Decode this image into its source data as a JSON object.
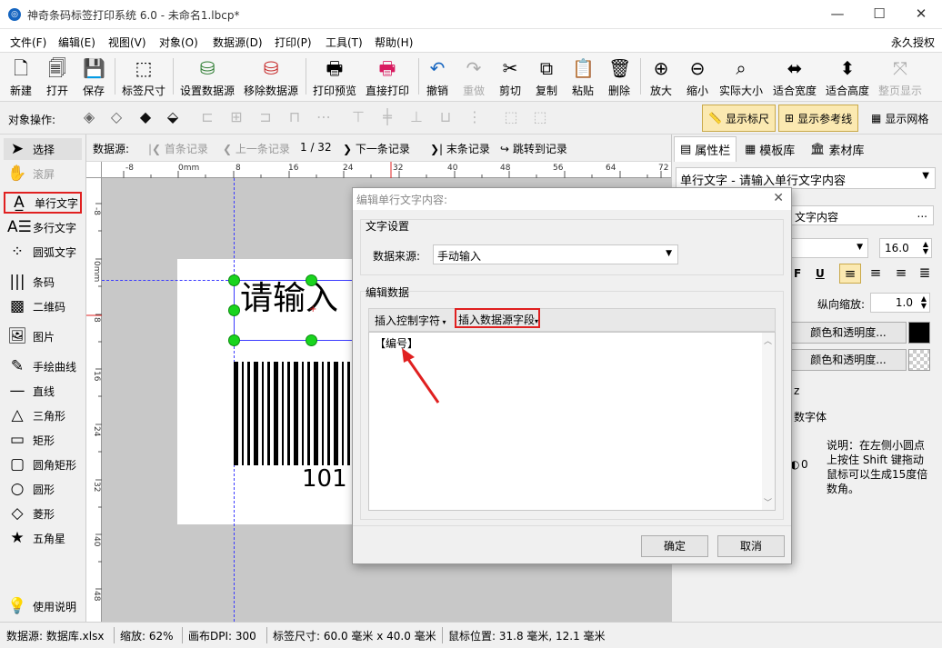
{
  "window": {
    "title": "神奇条码标签打印系统 6.0 - 未命名1.lbcp*",
    "app_icon": "app-logo-icon"
  },
  "menu": {
    "items": [
      "文件(F)",
      "编辑(E)",
      "视图(V)",
      "对象(O)",
      "数据源(D)",
      "打印(P)",
      "工具(T)",
      "帮助(H)"
    ],
    "license": "永久授权"
  },
  "toolbar": {
    "new": "新建",
    "open": "打开",
    "save": "保存",
    "label_size": "标签尺寸",
    "set_datasource": "设置数据源",
    "remove_datasource": "移除数据源",
    "print_preview": "打印预览",
    "direct_print": "直接打印",
    "undo": "撤销",
    "redo": "重做",
    "cut": "剪切",
    "copy": "复制",
    "paste": "粘贴",
    "delete": "删除",
    "zoom_in": "放大",
    "zoom_out": "缩小",
    "actual_size": "实际大小",
    "fit_width": "适合宽度",
    "fit_height": "适合高度",
    "fit_page": "整页显示"
  },
  "objbar": {
    "label": "对象操作:",
    "show_ruler": "显示标尺",
    "show_guides": "显示参考线",
    "show_grid": "显示网格"
  },
  "tools": {
    "select": "选择",
    "pan": "滚屏",
    "single_text": "单行文字",
    "multi_text": "多行文字",
    "arc_text": "圆弧文字",
    "barcode": "条码",
    "qrcode": "二维码",
    "image": "图片",
    "freehand": "手绘曲线",
    "line": "直线",
    "triangle": "三角形",
    "rect": "矩形",
    "round_rect": "圆角矩形",
    "circle": "圆形",
    "diamond": "菱形",
    "star": "五角星",
    "help": "使用说明"
  },
  "datanav": {
    "label": "数据源:",
    "first": "首条记录",
    "prev": "上一条记录",
    "position": "1 / 32",
    "next": "下一条记录",
    "last": "末条记录",
    "jump": "跳转到记录"
  },
  "ruler": {
    "h_ticks": [
      "-8",
      "0mm",
      "8",
      "16",
      "24",
      "32",
      "40",
      "48",
      "56",
      "64",
      "72"
    ],
    "v_ticks": [
      "-8",
      "0mm",
      "8",
      "16",
      "24",
      "32",
      "40",
      "48"
    ]
  },
  "canvas": {
    "text_object": "请输入",
    "barcode_number": "101"
  },
  "rightpanel": {
    "tabs": [
      "属性栏",
      "模板库",
      "素材库"
    ],
    "object_select": "单行文字 - 请输入单行文字内容",
    "content_label": "文字内容",
    "font_size": "16.0",
    "v_scale_label": "纵向缩放:",
    "v_scale": "1.0",
    "color_btn1": "颜色和透明度...",
    "color_btn2": "颜色和透明度...",
    "misc1": "z",
    "misc2": "数字体",
    "rotation": "0",
    "note": "说明：在左侧小圆点上按住 Shift 键拖动鼠标可以生成15度倍数角。",
    "text_color": "#000000"
  },
  "dialog": {
    "title": "编辑单行文字内容:",
    "text_settings": "文字设置",
    "datasource_label": "数据来源:",
    "datasource_value": "手动输入",
    "edit_data": "编辑数据",
    "insert_ctrl": "插入控制字符",
    "insert_field": "插入数据源字段",
    "content": "【编号】",
    "ok": "确定",
    "cancel": "取消"
  },
  "status": {
    "datasource": "数据源: 数据库.xlsx",
    "zoom": "缩放: 62%",
    "dpi": "画布DPI: 300",
    "label_size": "标签尺寸: 60.0 毫米 x 40.0 毫米",
    "mouse": "鼠标位置: 31.8 毫米, 12.1 毫米"
  },
  "colors": {
    "highlight": "#e02020",
    "handle": "#19d41e",
    "guide": "#3a3aff"
  }
}
